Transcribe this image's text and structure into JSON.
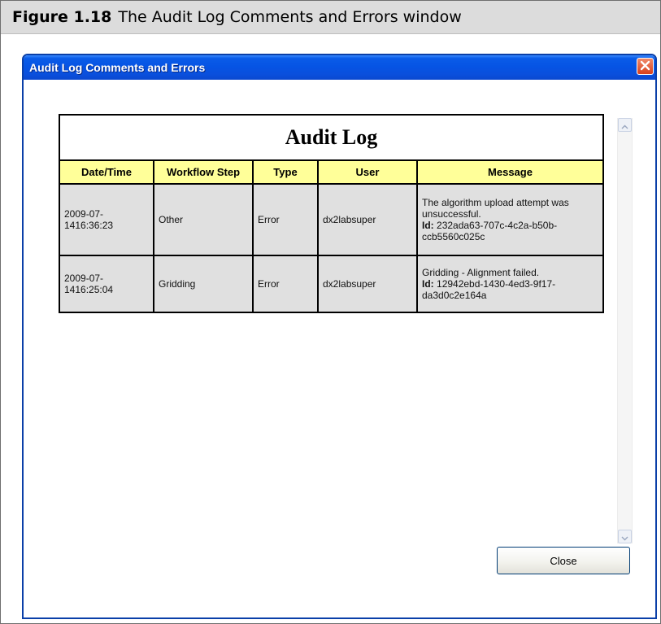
{
  "caption": {
    "label": "Figure 1.18",
    "text": "The Audit Log Comments and Errors window"
  },
  "window": {
    "title": "Audit Log Comments and Errors",
    "close_icon": "close-icon",
    "close_button_label": "Close"
  },
  "audit_log": {
    "title": "Audit Log",
    "columns": [
      "Date/Time",
      "Workflow Step",
      "Type",
      "User",
      "Message"
    ],
    "rows": [
      {
        "date_time_line1": "2009-07-",
        "date_time_line2": "1416:36:23",
        "workflow_step": "Other",
        "type": "Error",
        "user": "dx2labsuper",
        "message": "The algorithm upload attempt was unsuccessful.",
        "id_label": "Id:",
        "id_value": "232ada63-707c-4c2a-b50b-ccb5560c025c"
      },
      {
        "date_time_line1": "2009-07-",
        "date_time_line2": "1416:25:04",
        "workflow_step": "Gridding",
        "type": "Error",
        "user": "dx2labsuper",
        "message": "Gridding - Alignment failed.",
        "id_label": "Id:",
        "id_value": "12942ebd-1430-4ed3-9f17-da3d0c2e164a"
      }
    ]
  },
  "colors": {
    "titlebar": "#0654e4",
    "header_fill": "#ffff99",
    "cell_fill": "#e0e0e0",
    "close_x": "#d8401c"
  }
}
